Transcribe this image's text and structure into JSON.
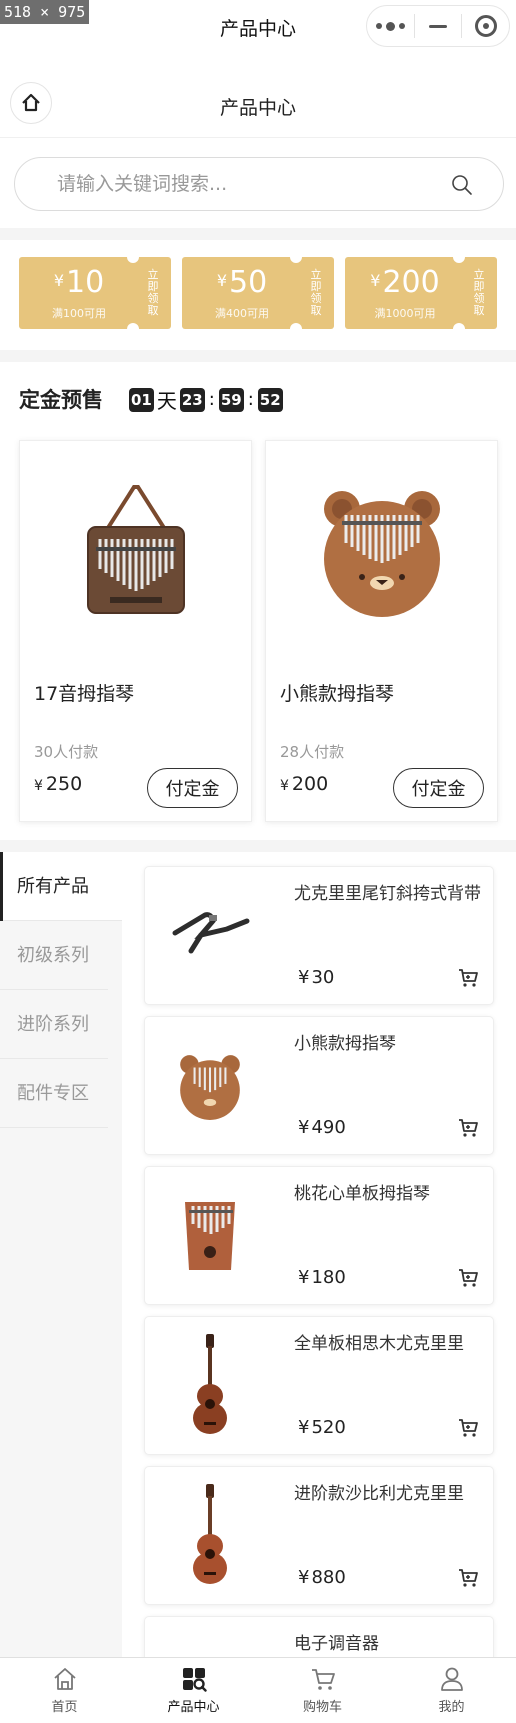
{
  "screen": {
    "dim_badge": "518 × 975"
  },
  "system_bar": {
    "title": "产品中心"
  },
  "nav": {
    "title": "产品中心"
  },
  "search": {
    "placeholder": "请输入关键词搜索..."
  },
  "coupons": [
    {
      "symbol": "¥",
      "amount": "10",
      "condition": "满100可用",
      "claim": "立即领取"
    },
    {
      "symbol": "¥",
      "amount": "50",
      "condition": "满400可用",
      "claim": "立即领取"
    },
    {
      "symbol": "¥",
      "amount": "200",
      "condition": "满1000可用",
      "claim": "立即领取"
    }
  ],
  "presale": {
    "title": "定金预售",
    "countdown": {
      "days": "01",
      "day_unit": "天",
      "hours": "23",
      "sep1": ":",
      "minutes": "59",
      "sep2": ":",
      "seconds": "52"
    },
    "items": [
      {
        "name": "17音拇指琴",
        "paid": "30人付款",
        "symbol": "¥",
        "price": "250",
        "button": "付定金"
      },
      {
        "name": "小熊款拇指琴",
        "paid": "28人付款",
        "symbol": "¥",
        "price": "200",
        "button": "付定金"
      }
    ]
  },
  "categories": [
    {
      "label": "所有产品"
    },
    {
      "label": "初级系列"
    },
    {
      "label": "进阶系列"
    },
    {
      "label": "配件专区"
    }
  ],
  "products": [
    {
      "name": "尤克里里尾钉斜挎式背带",
      "symbol": "¥",
      "price": "30"
    },
    {
      "name": "小熊款拇指琴",
      "symbol": "¥",
      "price": "490"
    },
    {
      "name": "桃花心单板拇指琴",
      "symbol": "¥",
      "price": "180"
    },
    {
      "name": "全单板相思木尤克里里",
      "symbol": "¥",
      "price": "520"
    },
    {
      "name": "进阶款沙比利尤克里里",
      "symbol": "¥",
      "price": "880"
    },
    {
      "name": "电子调音器",
      "symbol": "",
      "price": ""
    }
  ],
  "tabbar": [
    {
      "label": "首页",
      "icon": "home-icon"
    },
    {
      "label": "产品中心",
      "icon": "grid-search-icon"
    },
    {
      "label": "购物车",
      "icon": "cart-icon"
    },
    {
      "label": "我的",
      "icon": "user-icon"
    }
  ],
  "colors": {
    "coupon": "#e7c57d",
    "accent": "#222222"
  }
}
